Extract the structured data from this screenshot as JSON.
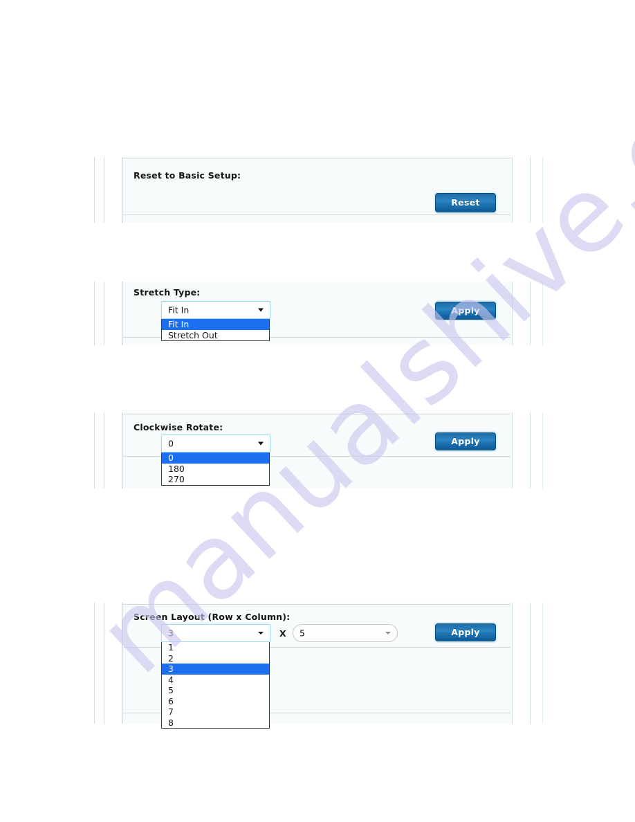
{
  "watermark": {
    "text": "manualshive.com"
  },
  "panels": [
    {
      "id": "reset-to-basic-setup",
      "label": "Reset to Basic Setup:",
      "button": {
        "label": "Reset",
        "name": "reset-button"
      }
    },
    {
      "id": "stretch-type",
      "label": "Stretch Type:",
      "select": {
        "name": "stretch-type-select",
        "value": "Fit In",
        "options": [
          "Fit In",
          "Stretch Out"
        ],
        "selected_index": 0,
        "expanded": true
      },
      "button": {
        "label": "Apply",
        "name": "apply-button"
      }
    },
    {
      "id": "clockwise-rotate",
      "label": "Clockwise Rotate:",
      "select": {
        "name": "clockwise-rotate-select",
        "value": "0",
        "options": [
          "0",
          "180",
          "270"
        ],
        "selected_index": 0,
        "expanded": true
      },
      "button": {
        "label": "Apply",
        "name": "apply-button"
      }
    },
    {
      "id": "screen-layout",
      "label": "Screen Layout (Row x Column):",
      "separator": "X",
      "select": {
        "name": "screen-layout-row-select",
        "value": "3",
        "options": [
          "1",
          "2",
          "3",
          "4",
          "5",
          "6",
          "7",
          "8"
        ],
        "selected_index": 2,
        "expanded": true
      },
      "select2": {
        "name": "screen-layout-column-select",
        "value": "5",
        "expanded": false
      },
      "button": {
        "label": "Apply",
        "name": "apply-button"
      }
    }
  ],
  "colors": {
    "accent_blue": "#1b6ff0",
    "button_blue": "#1f76b4",
    "panel_bg": "#f7fbfb",
    "focus_border": "#9fd9ee",
    "watermark": "#c9c6ee"
  }
}
